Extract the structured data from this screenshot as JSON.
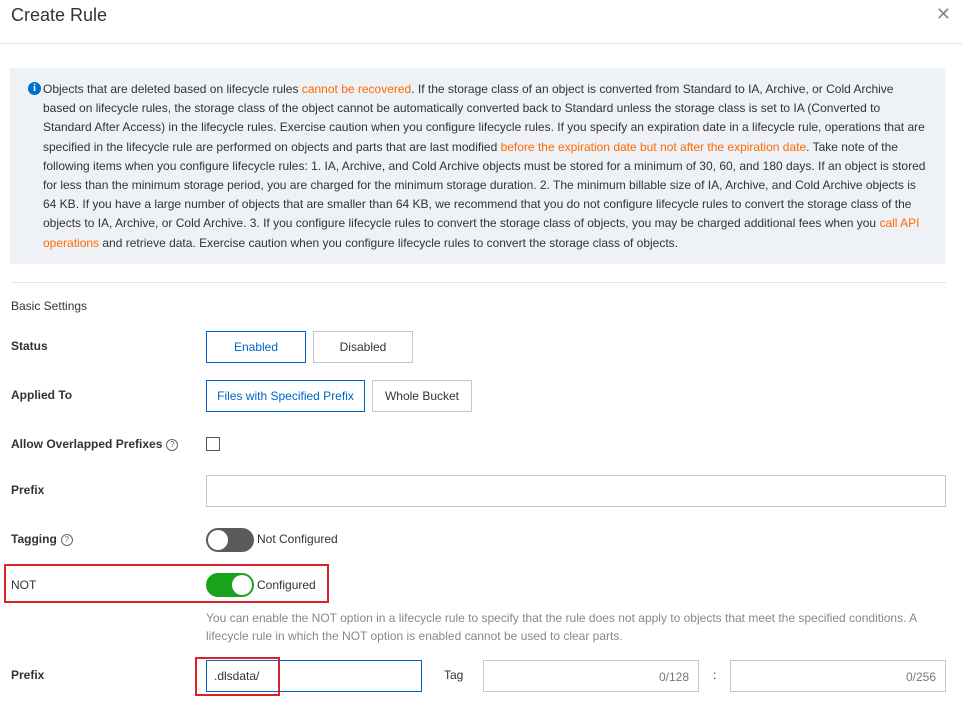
{
  "dialog": {
    "title": "Create Rule",
    "close_icon": "close-icon"
  },
  "notice": {
    "icon": "info-icon",
    "p1": "Objects that are deleted based on lifecycle rules ",
    "p1_hl": "cannot be recovered",
    "p2": ". If the storage class of an object is converted from Standard to IA, Archive, or Cold Archive based on lifecycle rules, the storage class of the object cannot be automatically converted back to Standard unless the storage class is set to IA (Converted to Standard After Access) in the lifecycle rules. Exercise caution when you configure lifecycle rules. If you specify an expiration date in a lifecycle rule, operations that are specified in the lifecycle rule are performed on objects and parts that are last modified ",
    "p2_hl": "before the expiration date but not after the expiration date",
    "p3": ". Take note of the following items when you configure lifecycle rules: 1. IA, Archive, and Cold Archive objects must be stored for a minimum of 30, 60, and 180 days. If an object is stored for less than the minimum storage period, you are charged for the minimum storage duration. 2. The minimum billable size of IA, Archive, and Cold Archive objects is 64 KB. If you have a large number of objects that are smaller than 64 KB, we recommend that you do not configure lifecycle rules to convert the storage class of the objects to IA, Archive, or Cold Archive. 3. If you configure lifecycle rules to convert the storage class of objects, you may be charged additional fees when you ",
    "link": "call API operations",
    "p4": " and retrieve data. Exercise caution when you configure lifecycle rules to convert the storage class of objects."
  },
  "basic_settings": {
    "heading": "Basic Settings",
    "status": {
      "label": "Status",
      "enabled": "Enabled",
      "disabled": "Disabled",
      "selected": "Enabled"
    },
    "applied_to": {
      "label": "Applied To",
      "prefix_option": "Files with Specified Prefix",
      "bucket_option": "Whole Bucket",
      "selected": "Files with Specified Prefix"
    },
    "allow_overlapped": {
      "label": "Allow Overlapped Prefixes",
      "help_icon": "question-circle-icon",
      "checked": false
    },
    "prefix": {
      "label": "Prefix",
      "value": ""
    },
    "tagging": {
      "label": "Tagging",
      "help_icon": "question-circle-icon",
      "on": false,
      "state_text": "Not Configured"
    },
    "not": {
      "label": "NOT",
      "on": true,
      "state_text": "Configured",
      "hint": "You can enable the NOT option in a lifecycle rule to specify that the rule does not apply to objects that meet the specified conditions. A lifecycle rule in which the NOT option is enabled cannot be used to clear parts."
    },
    "not_prefix": {
      "label": "Prefix",
      "value": ".dlsdata/",
      "tag_label": "Tag",
      "tag_key_counter": "0/128",
      "separator": ":",
      "tag_value_counter": "0/256"
    }
  },
  "colors": {
    "accent": "#0064c8",
    "highlight": "#ff6a00",
    "switch_on": "#1aa21c",
    "switch_off": "#5a5a5a",
    "annotation": "#d9222a"
  }
}
